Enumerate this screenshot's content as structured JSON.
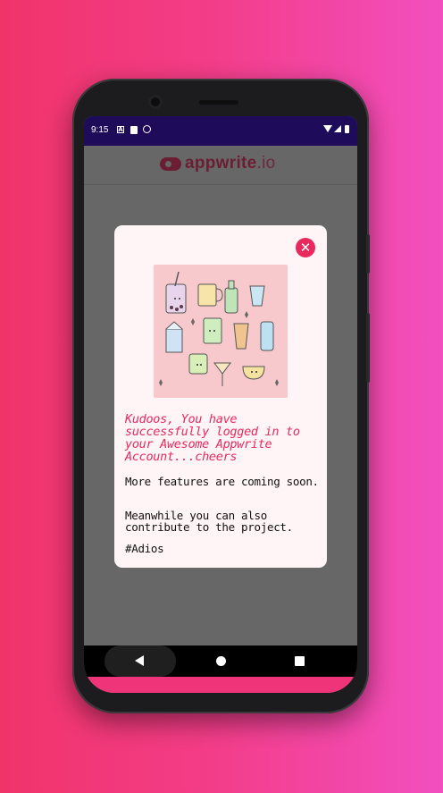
{
  "status_bar": {
    "time": "9:15",
    "left_icons": [
      "accessibility-icon",
      "sd-card-icon",
      "sync-icon"
    ],
    "right_icons": [
      "wifi-icon",
      "signal-icon",
      "battery-icon"
    ]
  },
  "app_bar": {
    "logo_text_bold": "appwrite",
    "logo_text_suffix": ".io"
  },
  "dialog": {
    "close_icon": "close-icon",
    "headline": "Kudoos, You have successfully logged in to your Awesome Appwrite Account...cheers",
    "paragraph_1": "More features are coming soon.",
    "paragraph_2": "Meanwhile you can also contribute to the project.",
    "signoff": "#Adios"
  },
  "nav_bar": {
    "buttons": [
      "back-icon",
      "home-icon",
      "recents-icon"
    ]
  },
  "colors": {
    "background_gradient_start": "#f0346a",
    "background_gradient_end": "#f24fbf",
    "status_bar": "#1e0c5a",
    "accent": "#e8295e",
    "dialog_background": "#fff5f7",
    "screen_scrim": "#676767",
    "bottom_strip": "#f0347a"
  }
}
